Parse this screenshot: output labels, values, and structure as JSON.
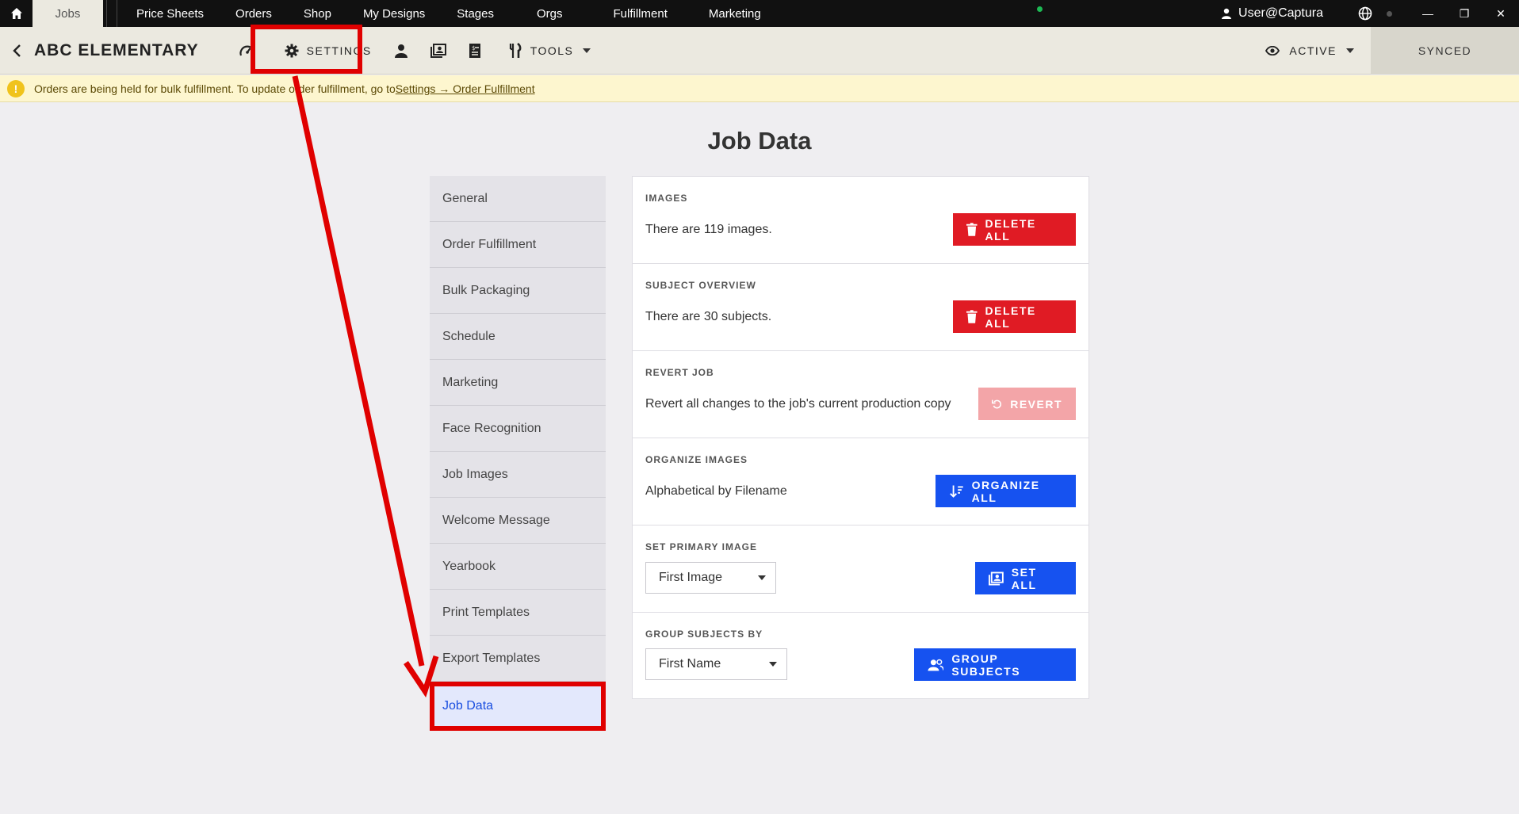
{
  "topbar": {
    "active_tab": "Jobs",
    "nav": [
      "Price Sheets",
      "Orders",
      "Shop",
      "My Designs",
      "Stages",
      "Orgs",
      "Fulfillment",
      "Marketing"
    ],
    "user": "User@Captura"
  },
  "jobbar": {
    "title": "ABC ELEMENTARY",
    "settings_label": "SETTINGS",
    "tools_label": "TOOLS",
    "status_label": "ACTIVE",
    "synced_label": "SYNCED"
  },
  "banner": {
    "text": "Orders are being held for bulk fulfillment. To update order fulfillment, go to ",
    "link": "Settings → Order Fulfillment"
  },
  "page": {
    "title": "Job Data"
  },
  "settings_nav": [
    "General",
    "Order Fulfillment",
    "Bulk Packaging",
    "Schedule",
    "Marketing",
    "Face Recognition",
    "Job Images",
    "Welcome Message",
    "Yearbook",
    "Print Templates",
    "Export Templates",
    "Job Data"
  ],
  "sections": {
    "images": {
      "label": "IMAGES",
      "text": "There are 119 images.",
      "button": "DELETE ALL"
    },
    "subjects": {
      "label": "SUBJECT OVERVIEW",
      "text": "There are 30 subjects.",
      "button": "DELETE ALL"
    },
    "revert": {
      "label": "REVERT JOB",
      "text": "Revert all changes to the job's current production copy",
      "button": "REVERT"
    },
    "organize": {
      "label": "ORGANIZE IMAGES",
      "text": "Alphabetical by Filename",
      "button": "ORGANIZE ALL"
    },
    "primary": {
      "label": "SET PRIMARY IMAGE",
      "select_value": "First Image",
      "button": "SET ALL"
    },
    "group": {
      "label": "GROUP SUBJECTS BY",
      "select_value": "First Name",
      "button": "GROUP SUBJECTS"
    }
  },
  "colors": {
    "danger": "#e01b24",
    "danger_disabled": "#f3a5a8",
    "primary": "#1652f0",
    "highlight": "#e00000",
    "banner_bg": "#fdf6cf"
  }
}
